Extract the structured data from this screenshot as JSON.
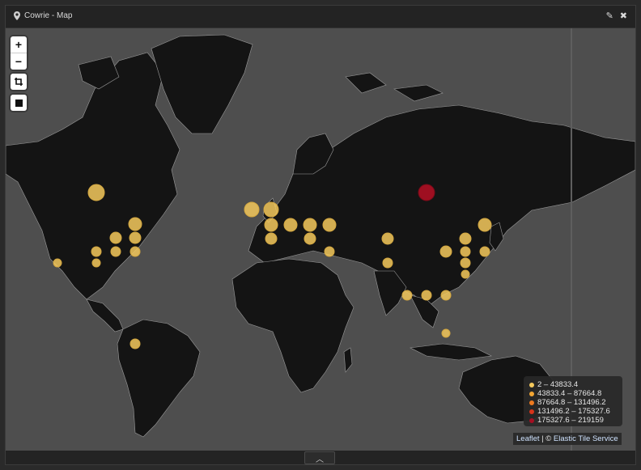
{
  "panel": {
    "title": "Cowrie - Map"
  },
  "toolbar": {
    "edit_icon": "pencil-icon",
    "close_icon": "close-icon",
    "edit_glyph": "✎",
    "close_glyph": "✖"
  },
  "controls": {
    "zoom_in": "+",
    "zoom_out": "−",
    "crop_icon": "crop-icon",
    "stop_icon": "square-icon"
  },
  "legend": {
    "items": [
      {
        "label": "2 – 43833.4",
        "color": "#f4c95d"
      },
      {
        "label": "43833.4 – 87664.8",
        "color": "#f2a533"
      },
      {
        "label": "87664.8 – 131496.2",
        "color": "#ee7a1f"
      },
      {
        "label": "131496.2 – 175327.6",
        "color": "#d8341a"
      },
      {
        "label": "175327.6 – 219159",
        "color": "#a50f22"
      }
    ]
  },
  "attribution": {
    "leaflet": "Leaflet",
    "separator": " | © ",
    "service": "Elastic Tile Service"
  },
  "footer": {
    "collapse_glyph": "︿"
  }
}
